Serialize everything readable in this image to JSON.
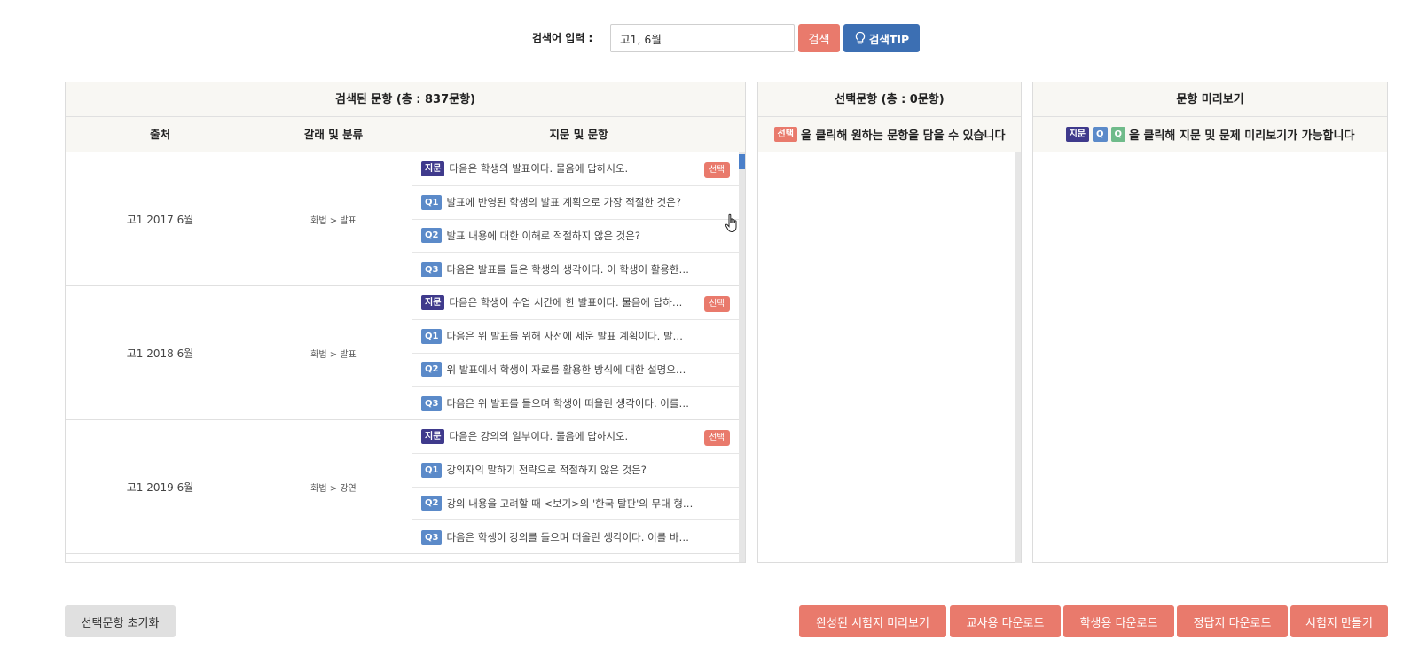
{
  "search": {
    "label": "검색어 입력 :",
    "value": "고1, 6월",
    "search_button": "검색",
    "tip_button": "검색TIP"
  },
  "results_panel": {
    "title": "검색된 문항 (총 : 837문항)",
    "columns": [
      "출처",
      "갈래 및 분류",
      "지문 및 문항"
    ],
    "groups": [
      {
        "source": "고1 2017 6월",
        "category": "화법 > 발표",
        "items": [
          {
            "tag": "지문",
            "text": "다음은 학생의 발표이다. 물음에 답하시오.",
            "select": "선택"
          },
          {
            "tag": "Q1",
            "text": "발표에 반영된 학생의 발표 계획으로 가장 적절한 것은?"
          },
          {
            "tag": "Q2",
            "text": "발표 내용에 대한 이해로 적절하지 않은 것은?"
          },
          {
            "tag": "Q3",
            "text": "다음은 발표를 들은 학생의 생각이다. 이 학생이 활용한…"
          }
        ]
      },
      {
        "source": "고1 2018 6월",
        "category": "화법 > 발표",
        "items": [
          {
            "tag": "지문",
            "text": "다음은 학생이 수업 시간에 한 발표이다. 물음에 답하…",
            "select": "선택"
          },
          {
            "tag": "Q1",
            "text": "다음은 위 발표를 위해 사전에 세운 발표 계획이다. 발…"
          },
          {
            "tag": "Q2",
            "text": "위 발표에서 학생이 자료를 활용한 방식에 대한 설명으…"
          },
          {
            "tag": "Q3",
            "text": "다음은 위 발표를 들으며 학생이 떠올린 생각이다. 이를…"
          }
        ]
      },
      {
        "source": "고1 2019 6월",
        "category": "화법 > 강연",
        "items": [
          {
            "tag": "지문",
            "text": "다음은 강의의 일부이다. 물음에 답하시오.",
            "select": "선택"
          },
          {
            "tag": "Q1",
            "text": "강의자의 말하기 전략으로 적절하지 않은 것은?"
          },
          {
            "tag": "Q2",
            "text": "강의 내용을 고려할 때 <보기>의 '한국 탈판'의 무대 형…"
          },
          {
            "tag": "Q3",
            "text": "다음은 학생이 강의를 들으며 떠올린 생각이다. 이를 바…"
          }
        ]
      }
    ]
  },
  "selected_panel": {
    "title": "선택문항 (총 : 0문항)",
    "hint_tag": "선택",
    "hint_text": "을 클릭해 원하는 문항을 담을 수 있습니다"
  },
  "preview_panel": {
    "title": "문항 미리보기",
    "hint_tags": [
      "지문",
      "Q",
      "Q"
    ],
    "hint_text": "을 클릭해 지문 및 문제 미리보기가 가능합니다"
  },
  "bottom": {
    "reset": "선택문항 초기화",
    "preview_exam": "완성된 시험지 미리보기",
    "teacher_download": "교사용 다운로드",
    "student_download": "학생용 다운로드",
    "answer_download": "정답지 다운로드",
    "make_exam": "시험지 만들기"
  },
  "colors": {
    "accent_red": "#e97a6c",
    "accent_blue": "#3c6fb3",
    "tag_jimun": "#3f3a8c",
    "tag_q": "#5b8ac9"
  }
}
